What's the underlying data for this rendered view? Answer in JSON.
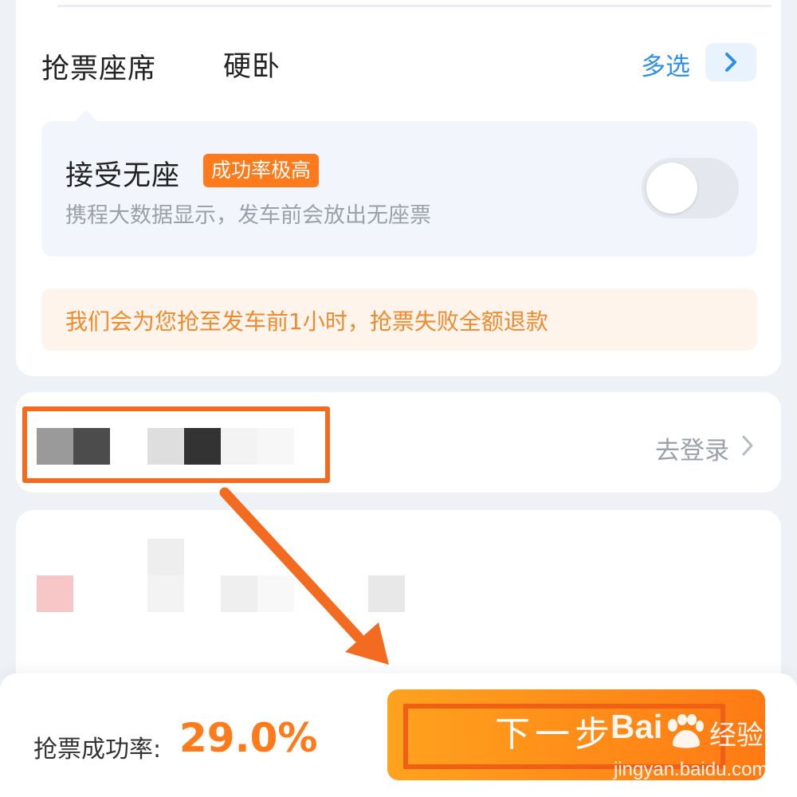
{
  "seat_section": {
    "label": "抢票座席",
    "value": "硬卧",
    "multi_select_label": "多选"
  },
  "no_seat": {
    "title": "接受无座",
    "badge": "成功率极高",
    "description": "携程大数据显示，发车前会放出无座票",
    "enabled": false
  },
  "refund_notice": "我们会为您抢至发车前1小时，抢票失败全额退款",
  "login_row": {
    "action_label": "去登录"
  },
  "bottom_bar": {
    "success_rate_label": "抢票成功率:",
    "success_rate_value": "29.0%",
    "next_button_label": "下一步"
  },
  "watermark": {
    "logo_text": "Bai",
    "logo_suffix": "经验",
    "url": "jingyan.baidu.com"
  },
  "colors": {
    "accent_orange": "#ff7a1a",
    "link_blue": "#2e8fe6",
    "annotation_orange": "#f26b21"
  }
}
